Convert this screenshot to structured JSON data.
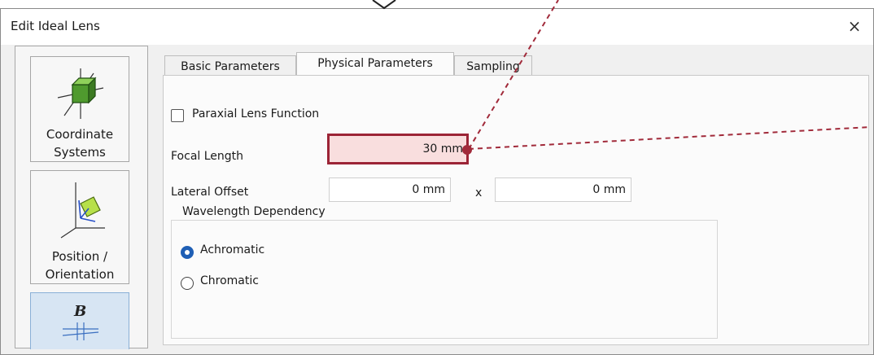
{
  "window": {
    "title": "Edit Ideal Lens",
    "close_glyph": "×"
  },
  "sidebar": {
    "items": [
      {
        "label_line1": "Coordinate",
        "label_line2": "Systems",
        "icon": "coordinate-systems-icon"
      },
      {
        "label_line1": "Position /",
        "label_line2": "Orientation",
        "icon": "position-orientation-icon"
      },
      {
        "label_line1": "",
        "label_line2": "",
        "icon": "b-field-icon",
        "selected": true
      }
    ]
  },
  "tabs": [
    {
      "label": "Basic Parameters"
    },
    {
      "label": "Physical Parameters",
      "active": true
    },
    {
      "label": "Sampling"
    }
  ],
  "physical": {
    "paraxial_label": "Paraxial Lens Function",
    "paraxial_checked": false,
    "focal_length_label": "Focal Length",
    "focal_length_value": "30 mm",
    "lateral_offset_label": "Lateral Offset",
    "lateral_offset_x": "0 mm",
    "lateral_offset_sep": "x",
    "lateral_offset_y": "0 mm",
    "wavelength_group_title": "Wavelength Dependency",
    "options": [
      {
        "label": "Achromatic",
        "selected": true
      },
      {
        "label": "Chromatic",
        "selected": false
      }
    ]
  },
  "colors": {
    "highlight": "#9c2436",
    "highlight_fill": "#f9dede",
    "radio_selected": "#1f5fb5"
  }
}
